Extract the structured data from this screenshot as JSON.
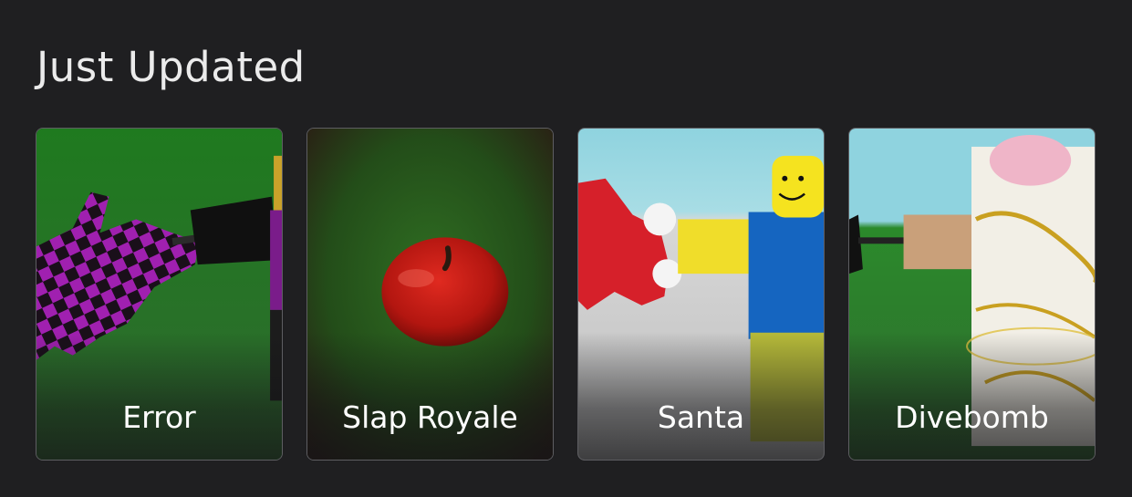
{
  "section": {
    "title": "Just Updated"
  },
  "cards": [
    {
      "title": "Error",
      "thumbnail": "error-glove-thumbnail"
    },
    {
      "title": "Slap Royale",
      "thumbnail": "apple-thumbnail"
    },
    {
      "title": "Santa",
      "thumbnail": "santa-glove-thumbnail"
    },
    {
      "title": "Divebomb",
      "thumbnail": "divebomb-glove-thumbnail"
    }
  ],
  "colors": {
    "background": "#1f1f21",
    "card_border": "#5e5e62",
    "title_text": "#ebebeb",
    "card_text": "#ffffff"
  }
}
